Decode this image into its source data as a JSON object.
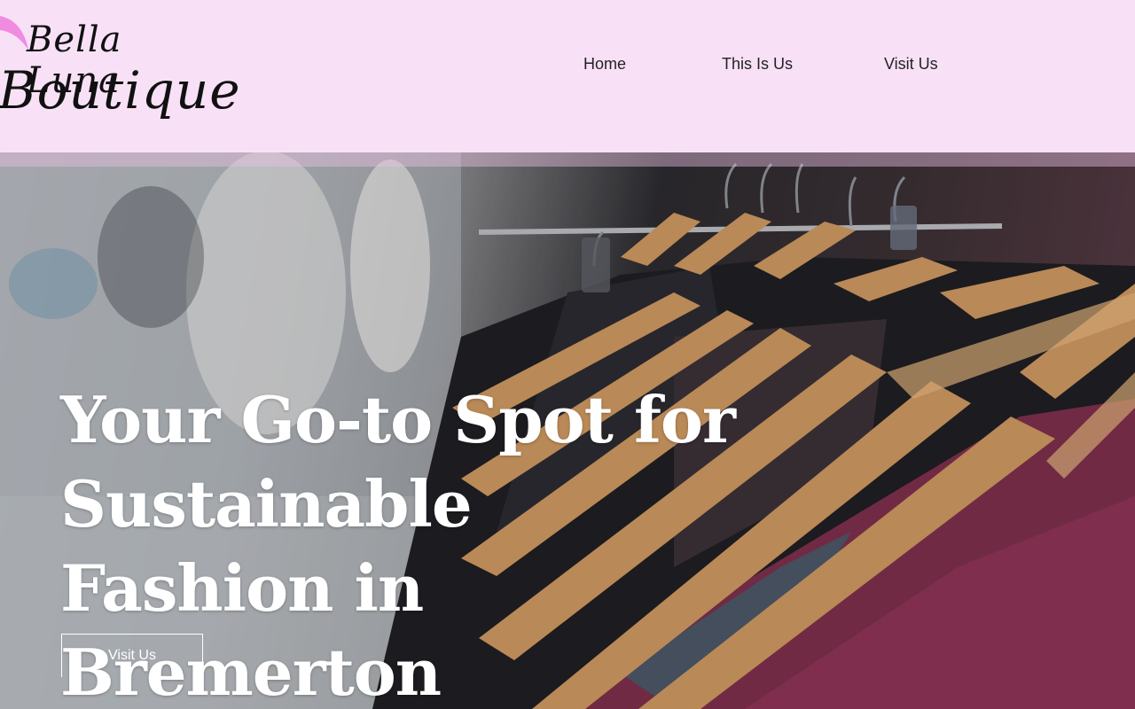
{
  "logo": {
    "line1": "Bella Luna",
    "line2": "Boutique"
  },
  "nav": {
    "items": [
      {
        "label": "Home"
      },
      {
        "label": "This Is Us"
      },
      {
        "label": "Visit Us"
      }
    ]
  },
  "hero": {
    "headline": "Your Go-to Spot for Sustainable Fashion in Bremerton",
    "cta_label": "Visit Us",
    "image_subject": "clothing-rack-hangers-photo"
  },
  "colors": {
    "header_bg": "#f8e1f7",
    "accent_pink": "#f08be0",
    "hero_text": "#ffffff"
  }
}
